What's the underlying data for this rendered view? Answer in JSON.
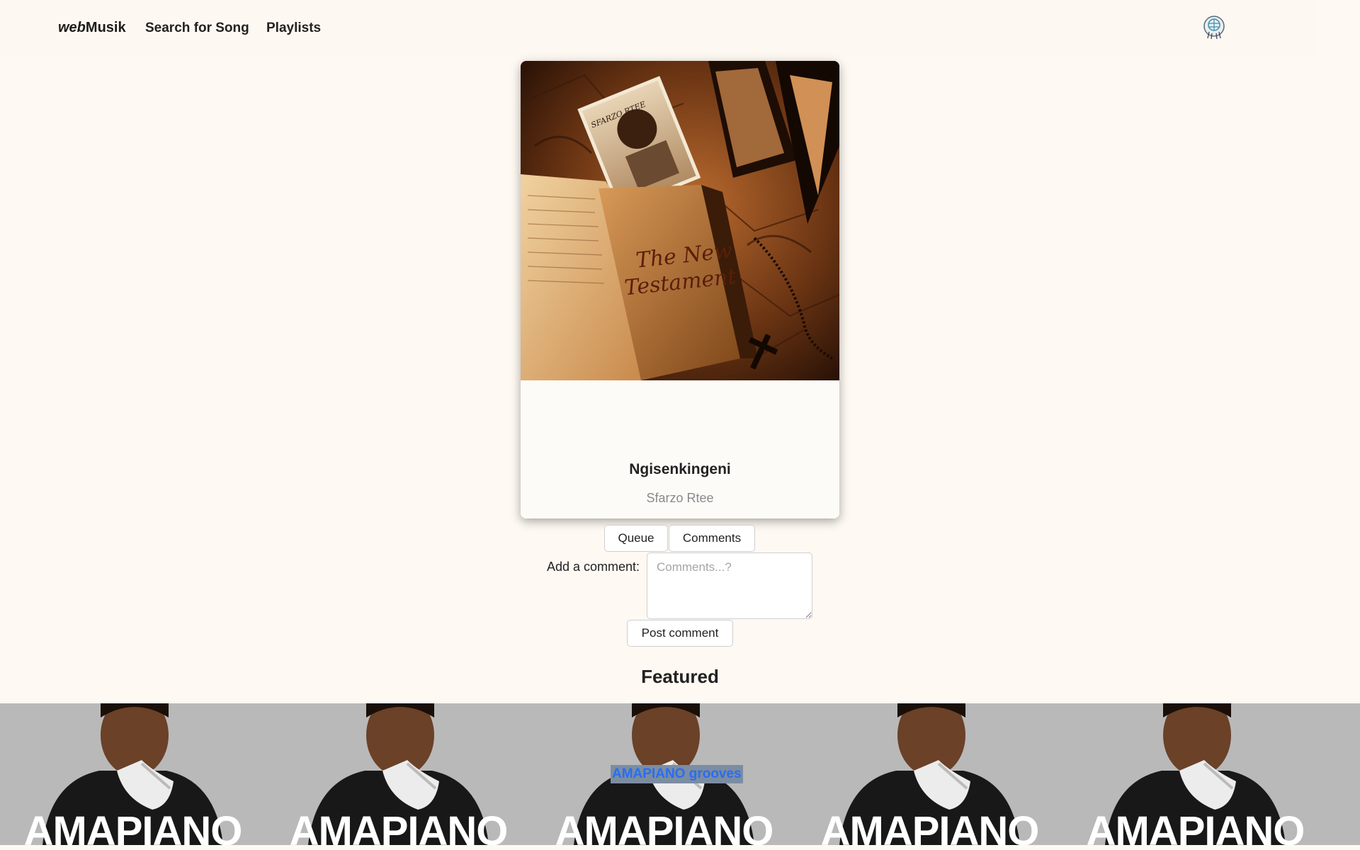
{
  "nav": {
    "brand_prefix": "web",
    "brand_suffix": "Musik",
    "links": [
      "Search for Song",
      "Playlists"
    ]
  },
  "player": {
    "song_title": "Ngisenkingeni",
    "artist": "Sfarzo Rtee",
    "cover_text_line1": "The New",
    "cover_text_line2": "Testament",
    "cover_photo_text": "SFARZO RTEE",
    "controls": [
      "skip-previous-icon",
      "play-icon",
      "skip-next-icon"
    ]
  },
  "tabs": {
    "queue": "Queue",
    "comments": "Comments"
  },
  "comment_form": {
    "label": "Add a comment:",
    "placeholder": "Comments...?",
    "submit": "Post comment"
  },
  "featured": {
    "heading": "Featured",
    "banner_text": "AMAPIANO",
    "caption": "AMAPIANO grooves"
  },
  "colors": {
    "page_bg": "#fef9f2",
    "banner_bg": "#b9b9b9",
    "caption_text": "#2a6df0",
    "icon_gray": "#777777"
  }
}
